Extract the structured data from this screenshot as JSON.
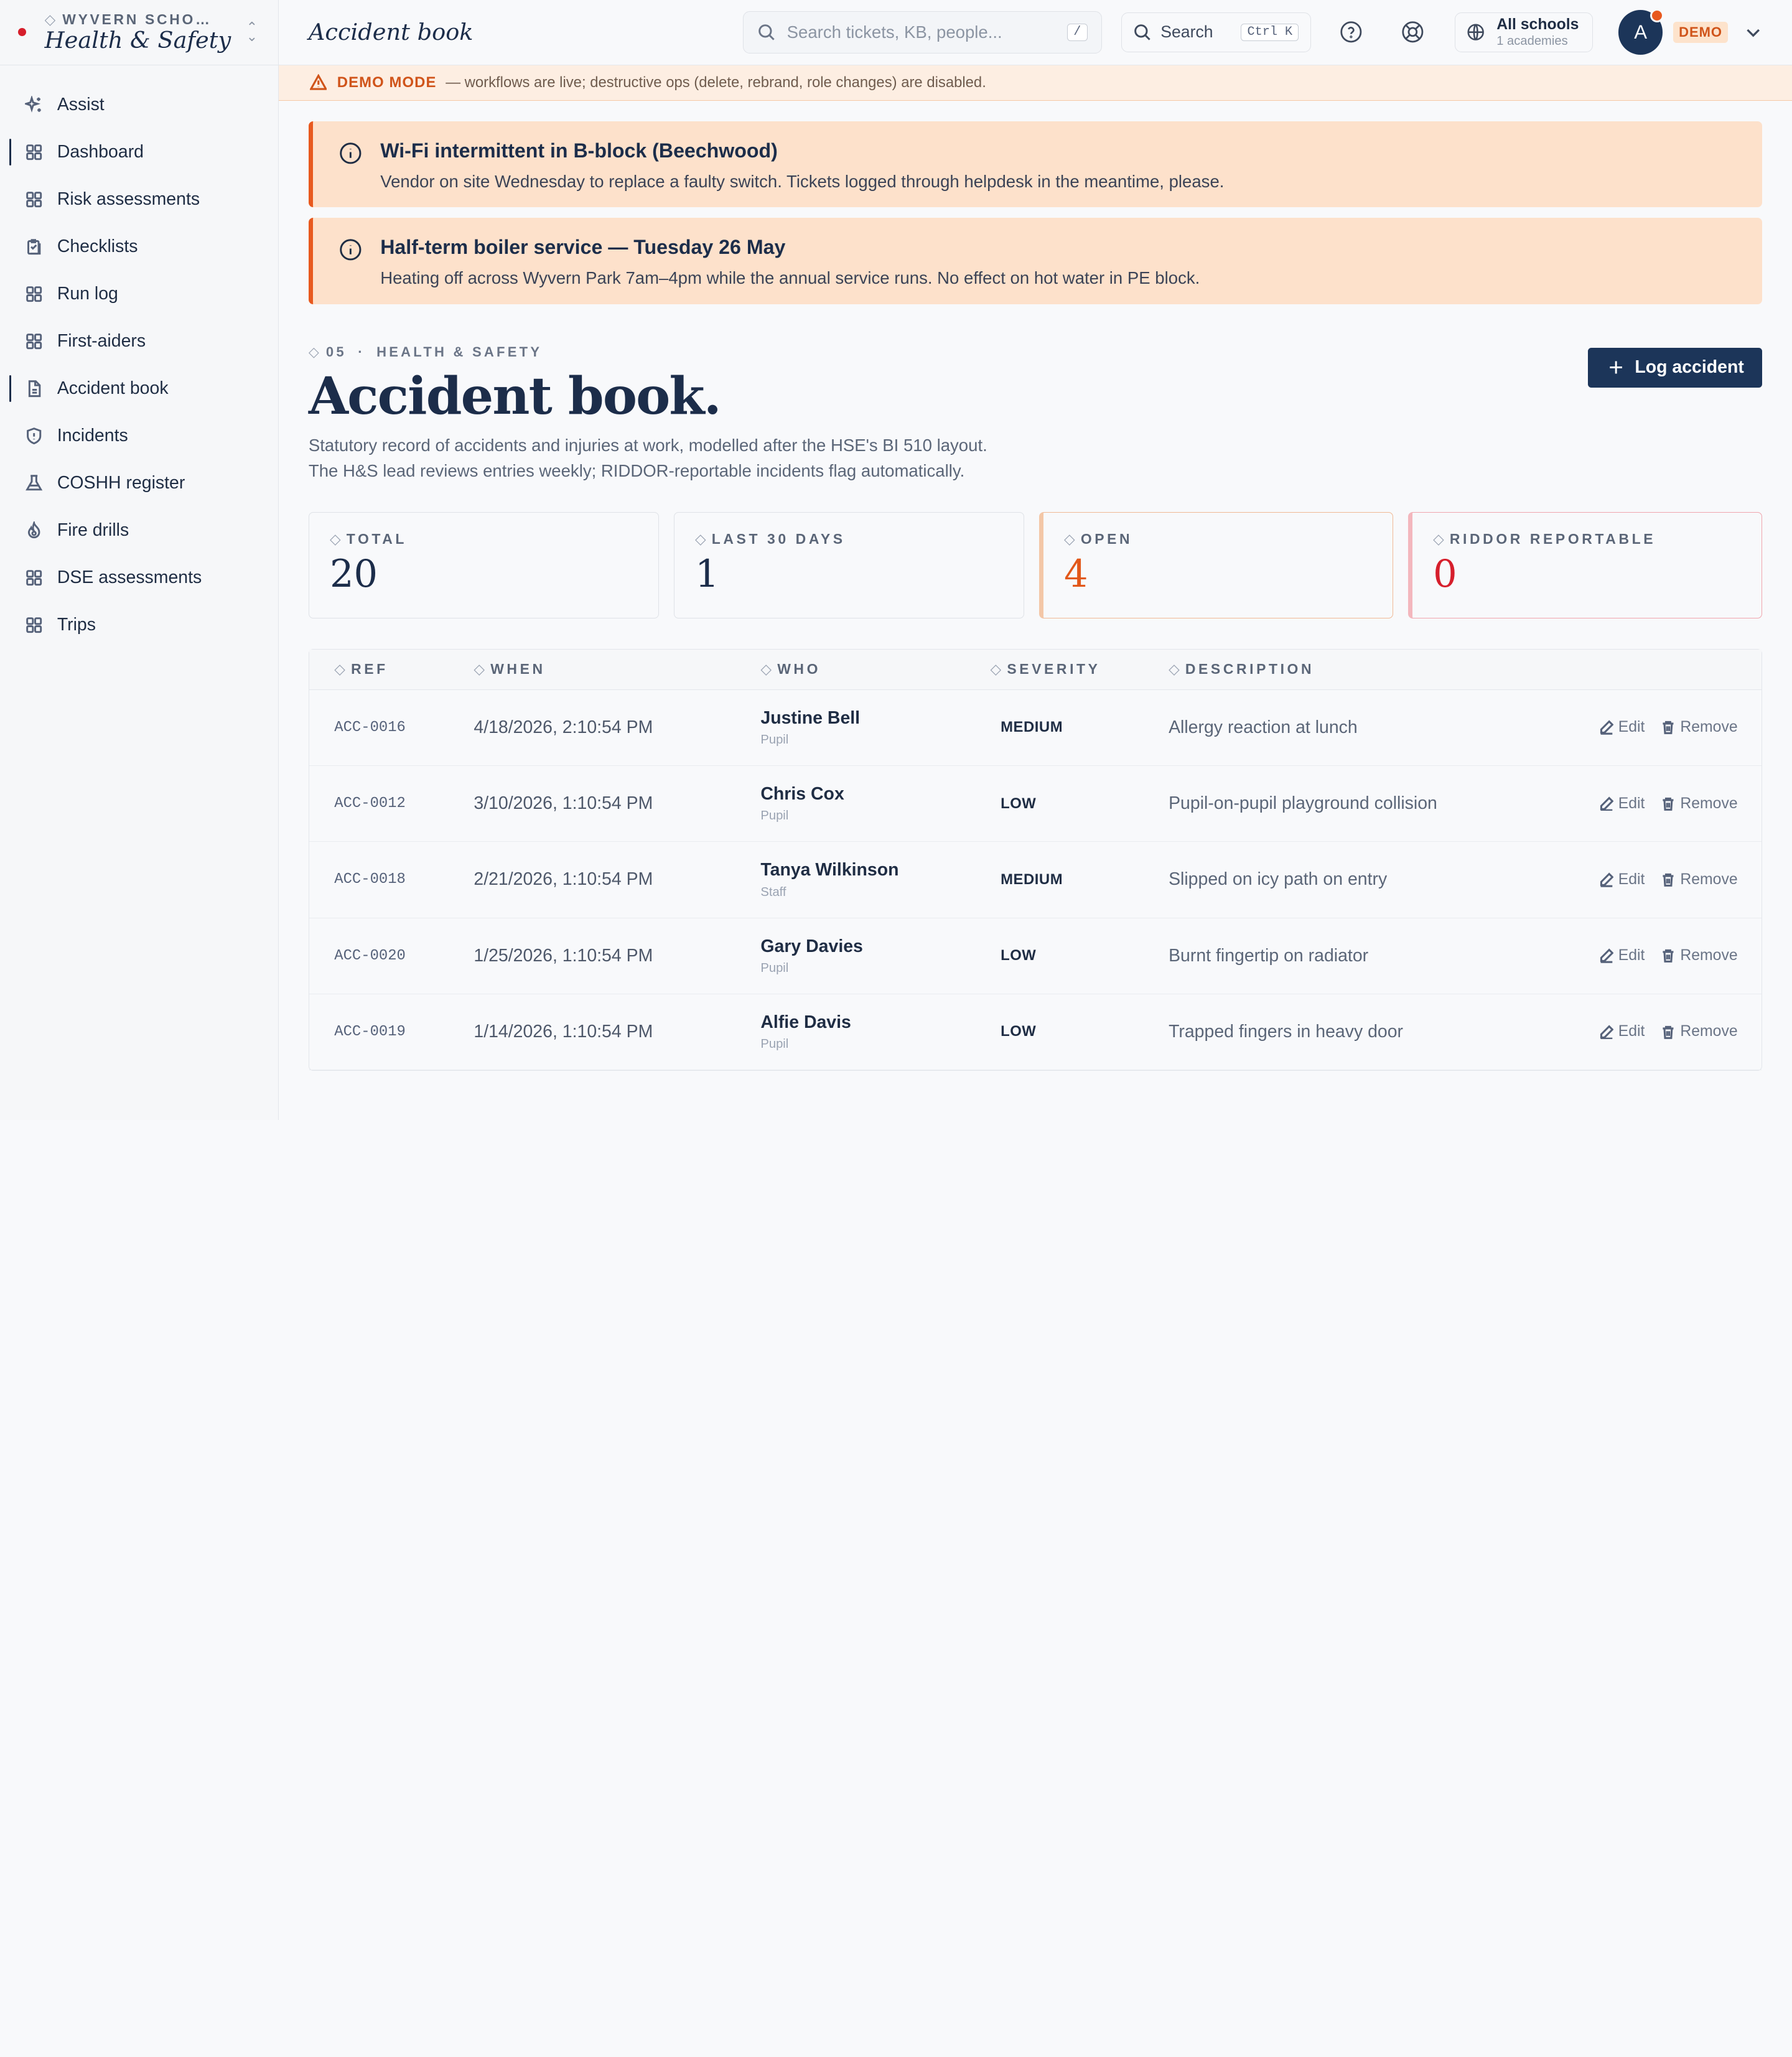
{
  "brand": {
    "org": "WYVERN SCHOO…",
    "org_diamond": "◇",
    "name": "Health & Safety",
    "accent": "#d61f2c"
  },
  "sidebar": {
    "items": [
      {
        "label": "Assist",
        "icon": "sparkle-icon"
      },
      {
        "label": "Dashboard",
        "icon": "grid-icon"
      },
      {
        "label": "Risk assessments",
        "icon": "grid-icon"
      },
      {
        "label": "Checklists",
        "icon": "clipboard-icon"
      },
      {
        "label": "Run log",
        "icon": "grid-icon"
      },
      {
        "label": "First-aiders",
        "icon": "grid-icon"
      },
      {
        "label": "Accident book",
        "icon": "document-icon"
      },
      {
        "label": "Incidents",
        "icon": "shield-icon"
      },
      {
        "label": "COSHH register",
        "icon": "flask-icon"
      },
      {
        "label": "Fire drills",
        "icon": "flame-icon"
      },
      {
        "label": "DSE assessments",
        "icon": "grid-icon"
      },
      {
        "label": "Trips",
        "icon": "grid-icon"
      }
    ]
  },
  "topbar": {
    "title": "Accident book",
    "search_placeholder": "Search tickets, KB, people...",
    "search_shortcut": "/",
    "search_button": "Search",
    "search_button_shortcut": "Ctrl K",
    "school_picker": {
      "label": "All schools",
      "sub": "1 academies"
    },
    "avatar_initial": "A",
    "demo_badge": "DEMO"
  },
  "demo_strip": {
    "tag": "DEMO MODE",
    "text": "— workflows are live; destructive ops (delete, rebrand, role changes) are disabled."
  },
  "banners": [
    {
      "title": "Wi-Fi intermittent in B-block (Beechwood)",
      "body": "Vendor on site Wednesday to replace a faulty switch. Tickets logged through helpdesk in the meantime, please."
    },
    {
      "title": "Half-term boiler service — Tuesday 26 May",
      "body": "Heating off across Wyvern Park 7am–4pm while the annual service runs. No effect on hot water in PE block."
    }
  ],
  "page": {
    "eyebrow_num": "05",
    "eyebrow_sep": "·",
    "eyebrow_label": "HEALTH & SAFETY",
    "diamond": "◇",
    "title": "Accident book.",
    "lede": "Statutory record of accidents and injuries at work, modelled after the HSE's BI 510 layout. The H&S lead reviews entries weekly; RIDDOR-reportable incidents flag automatically.",
    "primary_button": "Log accident",
    "primary_plus": "+"
  },
  "stats": [
    {
      "label": "TOTAL",
      "value": "20"
    },
    {
      "label": "LAST 30 DAYS",
      "value": "1"
    },
    {
      "label": "OPEN",
      "value": "4"
    },
    {
      "label": "RIDDOR REPORTABLE",
      "value": "0"
    }
  ],
  "table": {
    "headers": [
      "REF",
      "WHEN",
      "WHO",
      "SEVERITY",
      "DESCRIPTION"
    ],
    "edit_label": "Edit",
    "remove_label": "Remove",
    "rows": [
      {
        "ref": "ACC-0016",
        "when": "4/18/2026, 2:10:54 PM",
        "name": "Justine Bell",
        "role": "Pupil",
        "severity": "MEDIUM",
        "description": "Allergy reaction at lunch"
      },
      {
        "ref": "ACC-0012",
        "when": "3/10/2026, 1:10:54 PM",
        "name": "Chris Cox",
        "role": "Pupil",
        "severity": "LOW",
        "description": "Pupil-on-pupil playground collision"
      },
      {
        "ref": "ACC-0018",
        "when": "2/21/2026, 1:10:54 PM",
        "name": "Tanya Wilkinson",
        "role": "Staff",
        "severity": "MEDIUM",
        "description": "Slipped on icy path on entry"
      },
      {
        "ref": "ACC-0020",
        "when": "1/25/2026, 1:10:54 PM",
        "name": "Gary Davies",
        "role": "Pupil",
        "severity": "LOW",
        "description": "Burnt fingertip on radiator"
      },
      {
        "ref": "ACC-0019",
        "when": "1/14/2026, 1:10:54 PM",
        "name": "Alfie Davis",
        "role": "Pupil",
        "severity": "LOW",
        "description": "Trapped fingers in heavy door"
      }
    ]
  }
}
